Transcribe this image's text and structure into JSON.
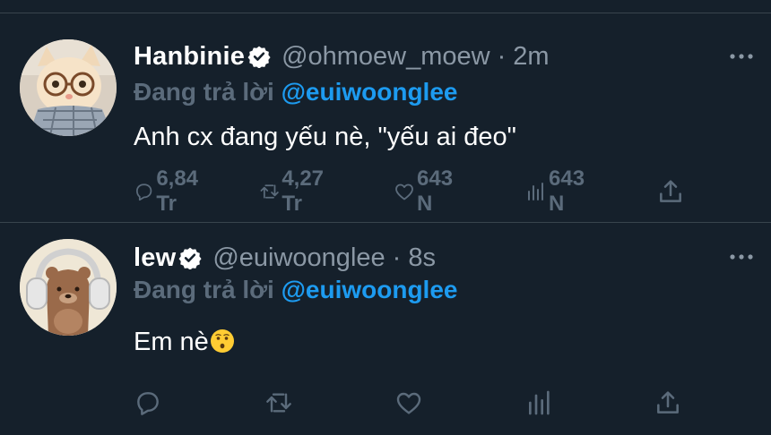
{
  "tweets": [
    {
      "name": "Hanbinie",
      "handle": "@ohmoew_moew",
      "separator": "·",
      "time": "2m",
      "reply_prefix": "Đang trả lời",
      "reply_to": "@euiwoonglee",
      "text": "Anh cx đang yếu nè, \"yếu ai đeo\"",
      "replies": "6,84 Tr",
      "retweets": "4,27 Tr",
      "likes": "643 N",
      "views": "643 N"
    },
    {
      "name": "lew",
      "handle": "@euiwoonglee",
      "separator": "·",
      "time": "8s",
      "reply_prefix": "Đang trả lời",
      "reply_to": "@euiwoonglee",
      "text": "Em nè",
      "emoji": "kissing-face",
      "replies": "",
      "retweets": "",
      "likes": "",
      "views": ""
    }
  ],
  "colors": {
    "background": "#15202b",
    "divider": "#38444d",
    "secondary_text": "#8b98a5",
    "muted_text": "#5b6b7b",
    "accent": "#1d9bf0"
  }
}
